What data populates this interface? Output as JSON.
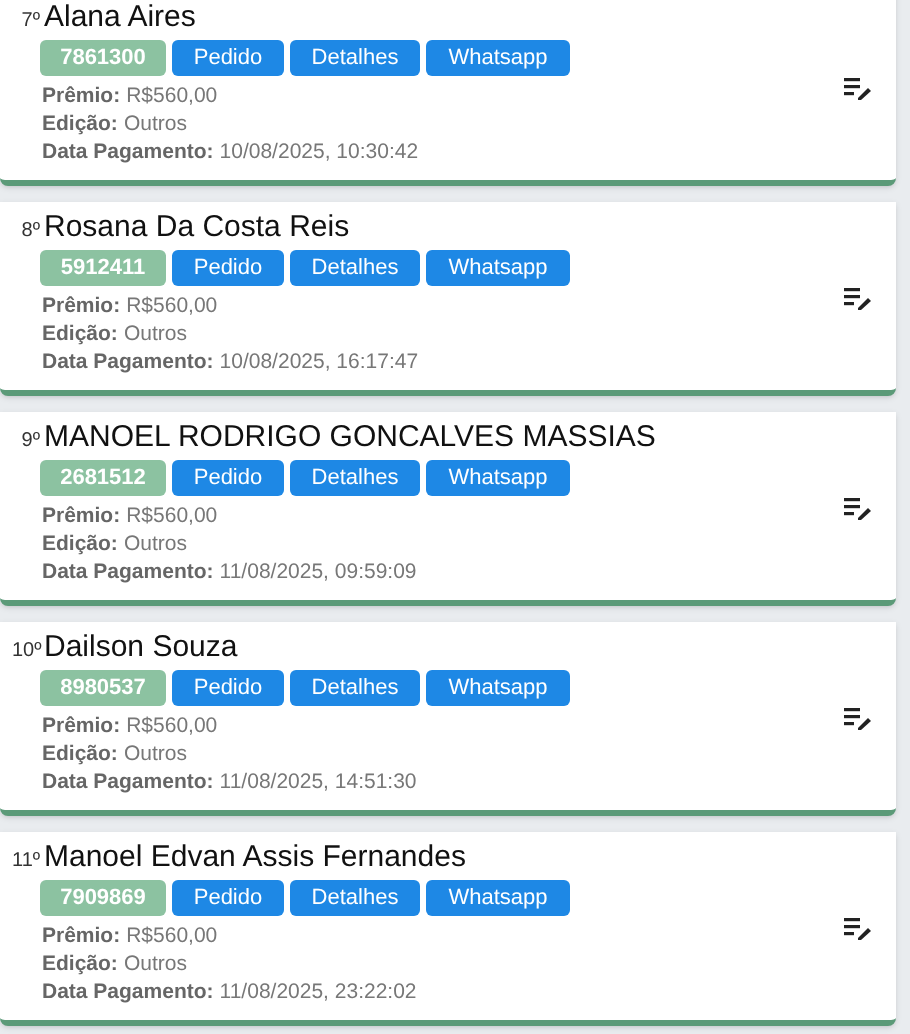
{
  "winners": [
    {
      "position": "7º",
      "name": "Alana Aires",
      "code": "7861300",
      "buttons": [
        "Pedido",
        "Detalhes",
        "Whatsapp"
      ],
      "fields": [
        {
          "label": "Prêmio:",
          "value": "R$560,00"
        },
        {
          "label": "Edição:",
          "value": "Outros"
        },
        {
          "label": "Data Pagamento:",
          "value": "10/08/2025, 10:30:42"
        }
      ]
    },
    {
      "position": "8º",
      "name": "Rosana Da Costa Reis",
      "code": "5912411",
      "buttons": [
        "Pedido",
        "Detalhes",
        "Whatsapp"
      ],
      "fields": [
        {
          "label": "Prêmio:",
          "value": "R$560,00"
        },
        {
          "label": "Edição:",
          "value": "Outros"
        },
        {
          "label": "Data Pagamento:",
          "value": "10/08/2025, 16:17:47"
        }
      ]
    },
    {
      "position": "9º",
      "name": "MANOEL RODRIGO GONCALVES MASSIAS",
      "code": "2681512",
      "buttons": [
        "Pedido",
        "Detalhes",
        "Whatsapp"
      ],
      "fields": [
        {
          "label": "Prêmio:",
          "value": "R$560,00"
        },
        {
          "label": "Edição:",
          "value": "Outros"
        },
        {
          "label": "Data Pagamento:",
          "value": "11/08/2025, 09:59:09"
        }
      ]
    },
    {
      "position": "10º",
      "name": "Dailson Souza",
      "code": "8980537",
      "buttons": [
        "Pedido",
        "Detalhes",
        "Whatsapp"
      ],
      "fields": [
        {
          "label": "Prêmio:",
          "value": "R$560,00"
        },
        {
          "label": "Edição:",
          "value": "Outros"
        },
        {
          "label": "Data Pagamento:",
          "value": "11/08/2025, 14:51:30"
        }
      ]
    },
    {
      "position": "11º",
      "name": "Manoel Edvan Assis Fernandes",
      "code": "7909869",
      "buttons": [
        "Pedido",
        "Detalhes",
        "Whatsapp"
      ],
      "fields": [
        {
          "label": "Prêmio:",
          "value": "R$560,00"
        },
        {
          "label": "Edição:",
          "value": "Outros"
        },
        {
          "label": "Data Pagamento:",
          "value": "11/08/2025, 23:22:02"
        }
      ]
    }
  ]
}
